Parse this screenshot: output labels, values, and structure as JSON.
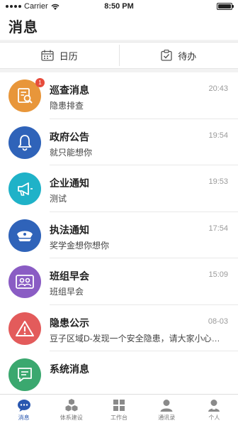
{
  "status": {
    "carrier": "Carrier",
    "time": "8:50 PM"
  },
  "header": {
    "title": "消息"
  },
  "quick": [
    {
      "label": "日历",
      "icon": "calendar-icon"
    },
    {
      "label": "待办",
      "icon": "todo-icon"
    }
  ],
  "messages": [
    {
      "title": "巡查消息",
      "subtitle": "隐患排查",
      "time": "20:43",
      "badge": "1",
      "icon": "inspection-icon",
      "color": "#e8963a"
    },
    {
      "title": "政府公告",
      "subtitle": "就只能想你",
      "time": "19:54",
      "badge": "",
      "icon": "bell-icon",
      "color": "#2f63b9"
    },
    {
      "title": "企业通知",
      "subtitle": "测试",
      "time": "19:53",
      "badge": "",
      "icon": "megaphone-icon",
      "color": "#1fb2c8"
    },
    {
      "title": "执法通知",
      "subtitle": "奖学金想你想你",
      "time": "17:54",
      "badge": "",
      "icon": "police-cap-icon",
      "color": "#2f63b9"
    },
    {
      "title": "班组早会",
      "subtitle": "班组早会",
      "time": "15:09",
      "badge": "",
      "icon": "meeting-icon",
      "color": "#8a5cc4"
    },
    {
      "title": "隐患公示",
      "subtitle": "豆子区域D-发现一个安全隐患，请大家小心…",
      "time": "08-03",
      "badge": "",
      "icon": "warning-icon",
      "color": "#e35b5b"
    },
    {
      "title": "系统消息",
      "subtitle": "",
      "time": "",
      "badge": "",
      "icon": "chat-icon",
      "color": "#3ba86f"
    }
  ],
  "tabs": [
    {
      "label": "消息",
      "icon": "message-icon",
      "active": true
    },
    {
      "label": "体系建设",
      "icon": "system-icon",
      "active": false
    },
    {
      "label": "工作台",
      "icon": "workbench-icon",
      "active": false
    },
    {
      "label": "通讯录",
      "icon": "contacts-icon",
      "active": false
    },
    {
      "label": "个人",
      "icon": "person-icon",
      "active": false
    }
  ],
  "colors": {
    "accent": "#2a57b0",
    "badge": "#e74c3c"
  }
}
